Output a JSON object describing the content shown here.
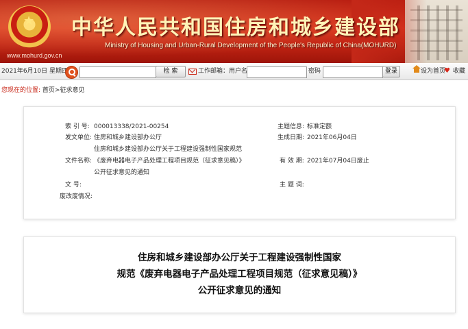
{
  "header": {
    "site_title": "中华人民共和国住房和城乡建设部",
    "site_subtitle": "Ministry of Housing and Urban-Rural Development of the People's Republic of China(MOHURD)",
    "site_url": "www.mohurd.gov.cn",
    "emblem_icon": "national-emblem",
    "brand_color": "#c8281a"
  },
  "toolbar": {
    "date": "2021年6月10日 星期四",
    "search_input_value": "",
    "search_button": "检 索",
    "mail_label": "工作邮箱：用户名",
    "username_value": "",
    "password_label": "密码",
    "password_value": "",
    "login_button": "登录",
    "homepage_link": "设为首页",
    "favorite_link": "收藏"
  },
  "breadcrumb": {
    "location_label": "您现在的位置:",
    "items": [
      "首页",
      "征求意见"
    ],
    "separator": ">"
  },
  "info": {
    "index_label": "索 引 号:",
    "index_value": "000013338/2021-00254",
    "subject_label": "主题信息:",
    "subject_value": "标准定额",
    "issuer_label": "发文单位:",
    "issuer_value": "住房和城乡建设部办公厅",
    "date_label": "生成日期:",
    "date_value": "2021年06月04日",
    "doc_title_label": "文件名称:",
    "doc_title_line1": "住房和城乡建设部办公厅关于工程建设强制性国家规范",
    "doc_title_line2": "《废弃电器电子产品处理工程项目规范（征求意见稿）》",
    "doc_title_line3": "公开征求意见的通知",
    "valid_label": "有 效 期:",
    "valid_value": "2021年07月04日废止",
    "docno_label": "文      号:",
    "docno_value": "",
    "keywords_label": "主 题 词:",
    "keywords_value": "",
    "abolish_label": "废改废情况:",
    "abolish_value": ""
  },
  "article": {
    "title_line1": "住房和城乡建设部办公厅关于工程建设强制性国家",
    "title_line2": "规范《废弃电器电子产品处理工程项目规范（征求意见稿）》",
    "title_line3": "公开征求意见的通知"
  }
}
